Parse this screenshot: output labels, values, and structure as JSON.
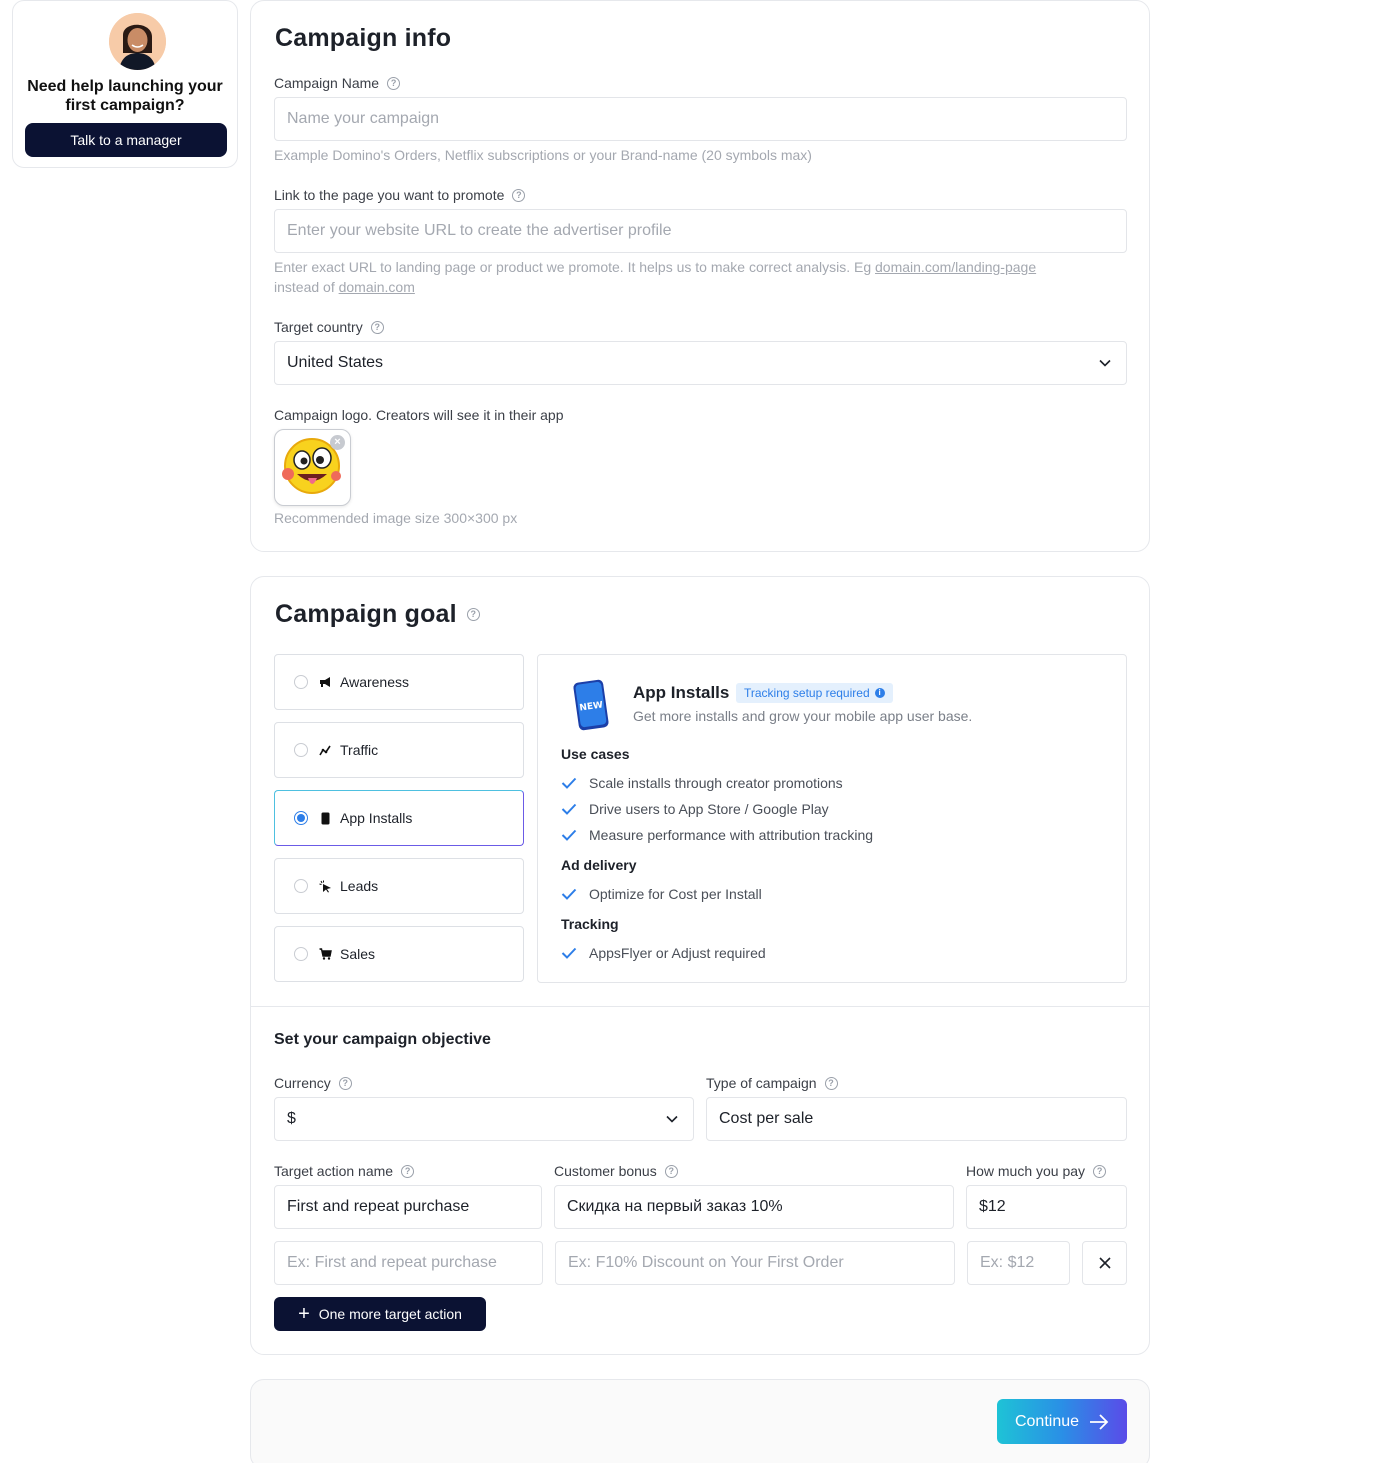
{
  "help": {
    "title": "Need help launching your first campaign?",
    "button": "Talk to a manager"
  },
  "campaign_info": {
    "title": "Campaign info",
    "name_label": "Campaign Name",
    "name_placeholder": "Name your campaign",
    "name_hint": "Example Domino's Orders, Netflix subscriptions or your Brand-name (20 symbols max)",
    "link_label": "Link to the page you want to promote",
    "link_placeholder": "Enter your website URL to create the advertiser profile",
    "link_hint_prefix": "Enter exact URL to landing page or product we promote. It helps us to make correct analysis. Eg",
    "link_hint_example": "domain.com/landing-page",
    "link_hint_mid": "instead of",
    "link_hint_domain": "domain.com",
    "country_label": "Target country",
    "country_value": "United States",
    "logo_label": "Campaign logo. Creators will see it in their app",
    "logo_hint": "Recommended image size 300×300 px"
  },
  "campaign_goal": {
    "title": "Campaign goal",
    "goals": [
      {
        "label": "Awareness",
        "icon": "megaphone-icon",
        "selected": false
      },
      {
        "label": "Traffic",
        "icon": "trend-icon",
        "selected": false
      },
      {
        "label": "App Installs",
        "icon": "phone-icon",
        "selected": true
      },
      {
        "label": "Leads",
        "icon": "cursor-click-icon",
        "selected": false
      },
      {
        "label": "Sales",
        "icon": "cart-icon",
        "selected": false
      }
    ],
    "detail": {
      "title": "App Installs",
      "badge": "Tracking setup required",
      "subtitle": "Get more installs and grow your mobile app user base.",
      "phone_text": "NEW",
      "use_cases_title": "Use cases",
      "use_cases": [
        "Scale installs through creator promotions",
        "Drive users to App Store / Google Play",
        "Measure performance with attribution tracking"
      ],
      "delivery_title": "Ad delivery",
      "delivery": [
        "Optimize for Cost per Install"
      ],
      "tracking_title": "Tracking",
      "tracking": [
        "AppsFlyer or Adjust required"
      ]
    }
  },
  "objective": {
    "title": "Set your campaign objective",
    "currency_label": "Currency",
    "currency_value": "$",
    "type_label": "Type of campaign",
    "type_value": "Cost per sale",
    "action_label": "Target action name",
    "bonus_label": "Customer bonus",
    "pay_label": "How much you pay",
    "row1": {
      "action": "First and repeat purchase",
      "bonus": "Скидка на первый заказ 10%",
      "pay": "$12"
    },
    "row2": {
      "action_placeholder": "Ex: First and repeat purchase",
      "bonus_placeholder": "Ex: F10% Discount on Your First Order",
      "pay_placeholder": "Ex: $12"
    },
    "add_button": "One more target action"
  },
  "footer": {
    "continue": "Continue"
  },
  "colors": {
    "primary_dark": "#0b1233",
    "accent_blue": "#2d7ee8",
    "gradient_start": "#1ec3d6",
    "gradient_end": "#5a4be8"
  }
}
